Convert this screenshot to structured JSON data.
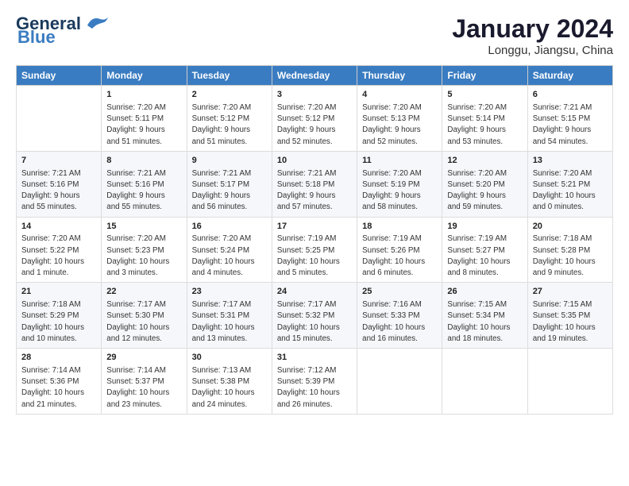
{
  "header": {
    "logo_line1": "General",
    "logo_line2": "Blue",
    "month_year": "January 2024",
    "location": "Longgu, Jiangsu, China"
  },
  "days_of_week": [
    "Sunday",
    "Monday",
    "Tuesday",
    "Wednesday",
    "Thursday",
    "Friday",
    "Saturday"
  ],
  "weeks": [
    [
      {
        "day": "",
        "info": ""
      },
      {
        "day": "1",
        "info": "Sunrise: 7:20 AM\nSunset: 5:11 PM\nDaylight: 9 hours\nand 51 minutes."
      },
      {
        "day": "2",
        "info": "Sunrise: 7:20 AM\nSunset: 5:12 PM\nDaylight: 9 hours\nand 51 minutes."
      },
      {
        "day": "3",
        "info": "Sunrise: 7:20 AM\nSunset: 5:12 PM\nDaylight: 9 hours\nand 52 minutes."
      },
      {
        "day": "4",
        "info": "Sunrise: 7:20 AM\nSunset: 5:13 PM\nDaylight: 9 hours\nand 52 minutes."
      },
      {
        "day": "5",
        "info": "Sunrise: 7:20 AM\nSunset: 5:14 PM\nDaylight: 9 hours\nand 53 minutes."
      },
      {
        "day": "6",
        "info": "Sunrise: 7:21 AM\nSunset: 5:15 PM\nDaylight: 9 hours\nand 54 minutes."
      }
    ],
    [
      {
        "day": "7",
        "info": "Sunrise: 7:21 AM\nSunset: 5:16 PM\nDaylight: 9 hours\nand 55 minutes."
      },
      {
        "day": "8",
        "info": "Sunrise: 7:21 AM\nSunset: 5:16 PM\nDaylight: 9 hours\nand 55 minutes."
      },
      {
        "day": "9",
        "info": "Sunrise: 7:21 AM\nSunset: 5:17 PM\nDaylight: 9 hours\nand 56 minutes."
      },
      {
        "day": "10",
        "info": "Sunrise: 7:21 AM\nSunset: 5:18 PM\nDaylight: 9 hours\nand 57 minutes."
      },
      {
        "day": "11",
        "info": "Sunrise: 7:20 AM\nSunset: 5:19 PM\nDaylight: 9 hours\nand 58 minutes."
      },
      {
        "day": "12",
        "info": "Sunrise: 7:20 AM\nSunset: 5:20 PM\nDaylight: 9 hours\nand 59 minutes."
      },
      {
        "day": "13",
        "info": "Sunrise: 7:20 AM\nSunset: 5:21 PM\nDaylight: 10 hours\nand 0 minutes."
      }
    ],
    [
      {
        "day": "14",
        "info": "Sunrise: 7:20 AM\nSunset: 5:22 PM\nDaylight: 10 hours\nand 1 minute."
      },
      {
        "day": "15",
        "info": "Sunrise: 7:20 AM\nSunset: 5:23 PM\nDaylight: 10 hours\nand 3 minutes."
      },
      {
        "day": "16",
        "info": "Sunrise: 7:20 AM\nSunset: 5:24 PM\nDaylight: 10 hours\nand 4 minutes."
      },
      {
        "day": "17",
        "info": "Sunrise: 7:19 AM\nSunset: 5:25 PM\nDaylight: 10 hours\nand 5 minutes."
      },
      {
        "day": "18",
        "info": "Sunrise: 7:19 AM\nSunset: 5:26 PM\nDaylight: 10 hours\nand 6 minutes."
      },
      {
        "day": "19",
        "info": "Sunrise: 7:19 AM\nSunset: 5:27 PM\nDaylight: 10 hours\nand 8 minutes."
      },
      {
        "day": "20",
        "info": "Sunrise: 7:18 AM\nSunset: 5:28 PM\nDaylight: 10 hours\nand 9 minutes."
      }
    ],
    [
      {
        "day": "21",
        "info": "Sunrise: 7:18 AM\nSunset: 5:29 PM\nDaylight: 10 hours\nand 10 minutes."
      },
      {
        "day": "22",
        "info": "Sunrise: 7:17 AM\nSunset: 5:30 PM\nDaylight: 10 hours\nand 12 minutes."
      },
      {
        "day": "23",
        "info": "Sunrise: 7:17 AM\nSunset: 5:31 PM\nDaylight: 10 hours\nand 13 minutes."
      },
      {
        "day": "24",
        "info": "Sunrise: 7:17 AM\nSunset: 5:32 PM\nDaylight: 10 hours\nand 15 minutes."
      },
      {
        "day": "25",
        "info": "Sunrise: 7:16 AM\nSunset: 5:33 PM\nDaylight: 10 hours\nand 16 minutes."
      },
      {
        "day": "26",
        "info": "Sunrise: 7:15 AM\nSunset: 5:34 PM\nDaylight: 10 hours\nand 18 minutes."
      },
      {
        "day": "27",
        "info": "Sunrise: 7:15 AM\nSunset: 5:35 PM\nDaylight: 10 hours\nand 19 minutes."
      }
    ],
    [
      {
        "day": "28",
        "info": "Sunrise: 7:14 AM\nSunset: 5:36 PM\nDaylight: 10 hours\nand 21 minutes."
      },
      {
        "day": "29",
        "info": "Sunrise: 7:14 AM\nSunset: 5:37 PM\nDaylight: 10 hours\nand 23 minutes."
      },
      {
        "day": "30",
        "info": "Sunrise: 7:13 AM\nSunset: 5:38 PM\nDaylight: 10 hours\nand 24 minutes."
      },
      {
        "day": "31",
        "info": "Sunrise: 7:12 AM\nSunset: 5:39 PM\nDaylight: 10 hours\nand 26 minutes."
      },
      {
        "day": "",
        "info": ""
      },
      {
        "day": "",
        "info": ""
      },
      {
        "day": "",
        "info": ""
      }
    ]
  ]
}
